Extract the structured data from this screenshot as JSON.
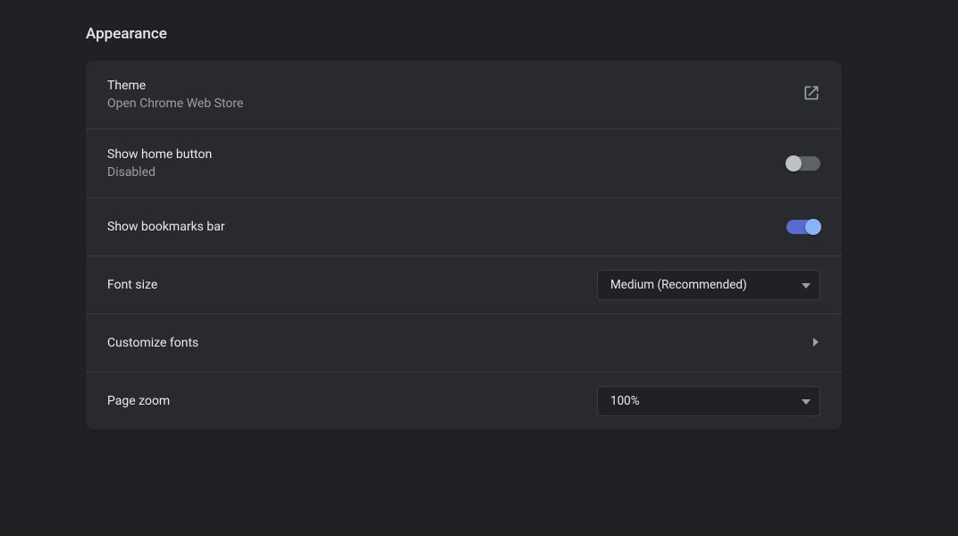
{
  "section_title": "Appearance",
  "rows": {
    "theme": {
      "label": "Theme",
      "sub": "Open Chrome Web Store"
    },
    "home_button": {
      "label": "Show home button",
      "sub": "Disabled",
      "on": false
    },
    "bookmarks_bar": {
      "label": "Show bookmarks bar",
      "on": true
    },
    "font_size": {
      "label": "Font size",
      "value": "Medium (Recommended)"
    },
    "customize_fonts": {
      "label": "Customize fonts"
    },
    "page_zoom": {
      "label": "Page zoom",
      "value": "100%"
    }
  }
}
